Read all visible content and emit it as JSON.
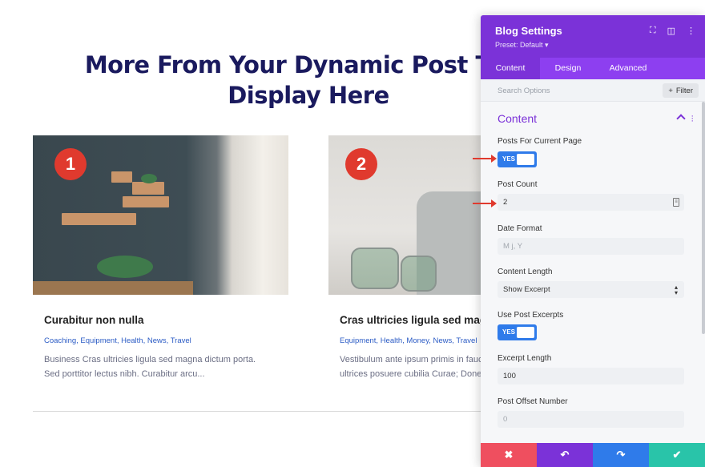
{
  "page": {
    "title": "More From Your Dynamic Post Title Display Here",
    "posts": [
      {
        "badge": "1",
        "title": "Curabitur non nulla",
        "categories": "Coaching, Equipment, Health, News, Travel",
        "excerpt_line1": "Business Cras ultricies ligula sed magna dictum porta.",
        "excerpt_line2": "Sed porttitor lectus nibh. Curabitur arcu..."
      },
      {
        "badge": "2",
        "title": "Cras ultricies ligula sed magna",
        "categories": "Equipment, Health, Money, News, Travel",
        "excerpt_line1": "Vestibulum ante ipsum primis in faucibus",
        "excerpt_line2": "ultrices posuere cubilia Curae; Donec"
      }
    ]
  },
  "panel": {
    "title": "Blog Settings",
    "preset": "Preset: Default ▾",
    "tabs": [
      "Content",
      "Design",
      "Advanced"
    ],
    "search_placeholder": "Search Options",
    "filter_label": "Filter",
    "section_title": "Content",
    "fields": {
      "posts_current_label": "Posts For Current Page",
      "posts_current_value": "YES",
      "post_count_label": "Post Count",
      "post_count_value": "2",
      "date_format_label": "Date Format",
      "date_format_placeholder": "M j, Y",
      "content_length_label": "Content Length",
      "content_length_value": "Show Excerpt",
      "use_excerpts_label": "Use Post Excerpts",
      "use_excerpts_value": "YES",
      "excerpt_length_label": "Excerpt Length",
      "excerpt_length_value": "100",
      "offset_label": "Post Offset Number",
      "offset_placeholder": "0"
    },
    "footer": {
      "cancel": "✖",
      "undo": "↶",
      "redo": "↷",
      "save": "✔"
    }
  },
  "colors": {
    "accent_purple": "#7b32d8",
    "toggle_blue": "#2f7bea",
    "badge_red": "#e03a2e",
    "title_navy": "#1a1a5e"
  }
}
